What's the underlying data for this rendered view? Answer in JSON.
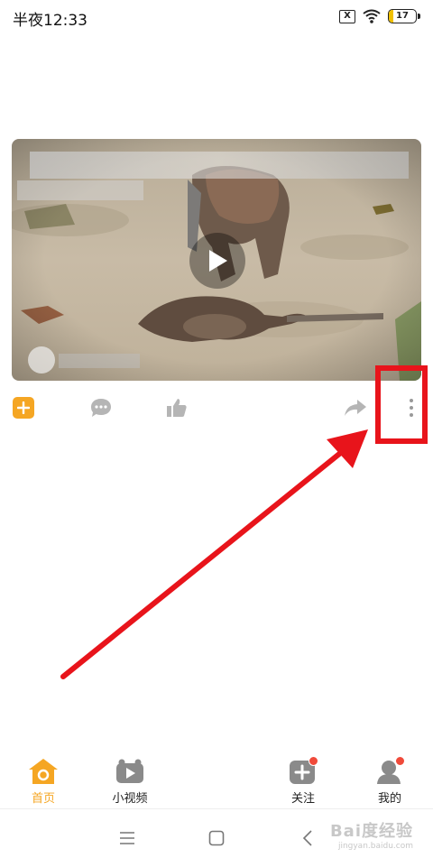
{
  "status_bar": {
    "time": "半夜12:33",
    "battery": "17",
    "sim": "X"
  },
  "bottom_nav": [
    {
      "label": "首页",
      "icon": "home-icon",
      "active": true
    },
    {
      "label": "小视频",
      "icon": "short-video-icon",
      "active": false
    },
    {
      "label": "关注",
      "icon": "follow-icon",
      "active": false,
      "badge": true
    },
    {
      "label": "我的",
      "icon": "profile-icon",
      "active": false,
      "badge": true
    }
  ],
  "watermark": {
    "main": "Bai度经验",
    "sub": "jingyan.baidu.com"
  },
  "colors": {
    "accent": "#f5a623",
    "annotation": "#e8141b",
    "badge": "#f04a3a",
    "icon_gray": "#b5b5b5"
  },
  "icons": {
    "action_bar": [
      "add-icon",
      "comment-icon",
      "like-icon",
      "share-icon",
      "more-icon"
    ],
    "system_nav": [
      "menu-icon",
      "home-square-icon",
      "back-icon"
    ]
  }
}
